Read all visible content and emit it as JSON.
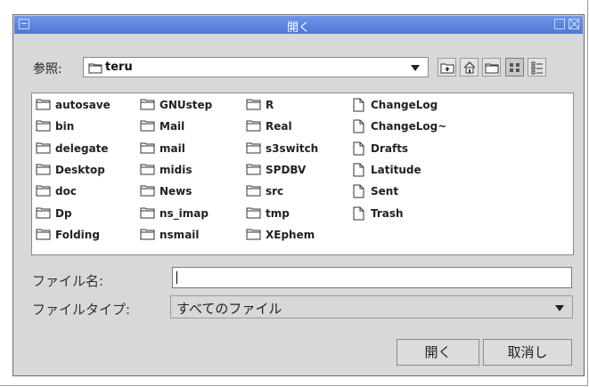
{
  "window": {
    "title": "開く"
  },
  "lookin": {
    "label": "参照:",
    "value": "teru"
  },
  "toolbar": {
    "up_icon": "up-folder-icon",
    "home_icon": "home-icon",
    "newfolder_icon": "new-folder-icon",
    "list_icon": "list-view-icon",
    "details_icon": "details-view-icon"
  },
  "files": {
    "col1": [
      "autosave",
      "bin",
      "delegate",
      "Desktop",
      "doc",
      "Dp",
      "Folding"
    ],
    "col2": [
      "GNUstep",
      "Mail",
      "mail",
      "midis",
      "News",
      "ns_imap",
      "nsmail"
    ],
    "col3": [
      "R",
      "Real",
      "s3switch",
      "SPDBV",
      "src",
      "tmp",
      "XEphem"
    ],
    "col4": [
      "ChangeLog",
      "ChangeLog~",
      "Drafts",
      "Latitude",
      "Sent",
      "Trash"
    ]
  },
  "filename": {
    "label": "ファイル名:",
    "value": ""
  },
  "filetype": {
    "label": "ファイルタイプ:",
    "value": "すべてのファイル"
  },
  "buttons": {
    "open": "開く",
    "cancel": "取消し"
  }
}
